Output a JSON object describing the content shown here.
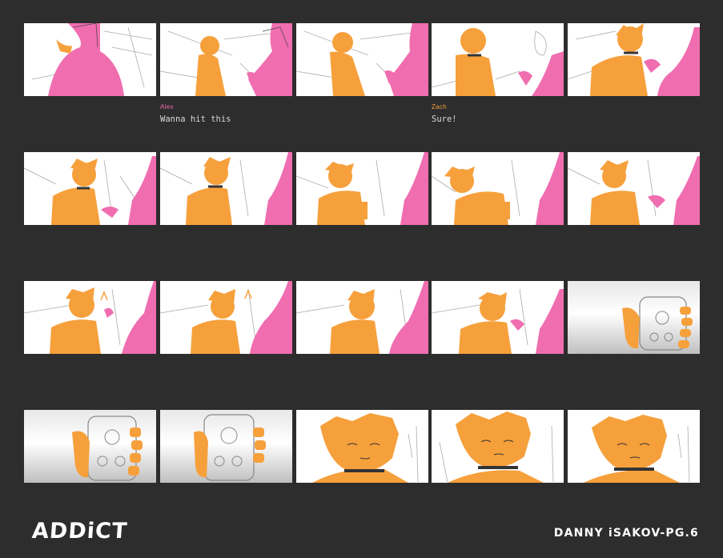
{
  "page": {
    "title": "ADDiCT",
    "credit": "DANNY iSAKOV-PG.6"
  },
  "colors": {
    "background": "#2d2d2d",
    "character_alex": "#f06db0",
    "character_zach": "#f6a03c",
    "sketch_line": "#999999"
  },
  "captions": [
    {
      "speaker": "Alex",
      "speaker_color": "#f06db0",
      "text": "Wanna hit this"
    },
    {
      "speaker": "Zach",
      "speaker_color": "#f6a03c",
      "text": "Sure!"
    }
  ],
  "rows": [
    {
      "panels": [
        "alex-back",
        "zach-sitting-alex-reaching",
        "zach-sitting-alex-reaching",
        "zach-alex-offer",
        "zach-takes-item"
      ]
    },
    {
      "panels": [
        "zach-hand-to-mouth",
        "zach-hand-to-mouth",
        "zach-hit",
        "zach-leans",
        "zach-hands-item-back"
      ]
    },
    {
      "panels": [
        "zach-lighter",
        "zach-lighter",
        "zach-lighter",
        "zach-looks-down",
        "phone-closeup"
      ]
    },
    {
      "panels": [
        "phone-closeup",
        "phone-closeup",
        "zach-face-closeup",
        "zach-face-closeup",
        "zach-face-closeup"
      ]
    }
  ]
}
